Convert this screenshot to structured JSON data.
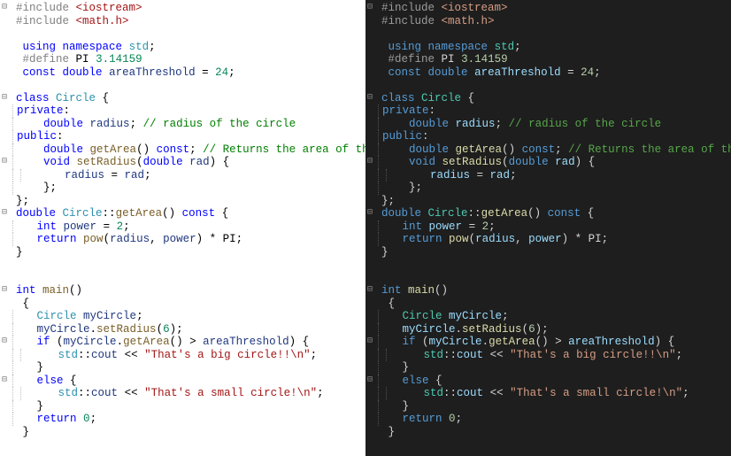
{
  "panes": [
    {
      "theme": "light"
    },
    {
      "theme": "dark"
    }
  ],
  "code_lines": [
    {
      "gutter": "⊟",
      "indent": 0,
      "tokens": [
        [
          "pp",
          "#include"
        ],
        [
          "p",
          " "
        ],
        [
          "s",
          "<iostream>"
        ]
      ]
    },
    {
      "gutter": "",
      "indent": 0,
      "tokens": [
        [
          "pp",
          "#include"
        ],
        [
          "p",
          " "
        ],
        [
          "s",
          "<math.h>"
        ]
      ]
    },
    {
      "gutter": "",
      "indent": 0,
      "tokens": []
    },
    {
      "gutter": "",
      "indent": 0,
      "tokens": [
        [
          "p",
          " "
        ],
        [
          "k",
          "using"
        ],
        [
          "p",
          " "
        ],
        [
          "k",
          "namespace"
        ],
        [
          "p",
          " "
        ],
        [
          "t",
          "std"
        ],
        [
          "p",
          ";"
        ]
      ]
    },
    {
      "gutter": "",
      "indent": 0,
      "tokens": [
        [
          "p",
          " "
        ],
        [
          "pp",
          "#define"
        ],
        [
          "p",
          " "
        ],
        [
          "d",
          "PI"
        ],
        [
          "p",
          " "
        ],
        [
          "n",
          "3.14159"
        ]
      ]
    },
    {
      "gutter": "",
      "indent": 0,
      "tokens": [
        [
          "p",
          " "
        ],
        [
          "k",
          "const"
        ],
        [
          "p",
          " "
        ],
        [
          "k",
          "double"
        ],
        [
          "p",
          " "
        ],
        [
          "v",
          "areaThreshold"
        ],
        [
          "p",
          " = "
        ],
        [
          "n",
          "24"
        ],
        [
          "p",
          ";"
        ]
      ]
    },
    {
      "gutter": "",
      "indent": 0,
      "tokens": []
    },
    {
      "gutter": "⊟",
      "indent": 0,
      "tokens": [
        [
          "k",
          "class"
        ],
        [
          "p",
          " "
        ],
        [
          "t",
          "Circle"
        ],
        [
          "p",
          " {"
        ]
      ]
    },
    {
      "gutter": "",
      "indent": 1,
      "tokens": [
        [
          "k",
          "private"
        ],
        [
          "p",
          ":"
        ]
      ]
    },
    {
      "gutter": "",
      "indent": 1,
      "tokens": [
        [
          "p",
          "    "
        ],
        [
          "k",
          "double"
        ],
        [
          "p",
          " "
        ],
        [
          "v",
          "radius"
        ],
        [
          "p",
          "; "
        ],
        [
          "c",
          "// radius of the circle"
        ]
      ]
    },
    {
      "gutter": "",
      "indent": 1,
      "tokens": [
        [
          "k",
          "public"
        ],
        [
          "p",
          ":"
        ]
      ]
    },
    {
      "gutter": "",
      "indent": 1,
      "tokens": [
        [
          "p",
          "    "
        ],
        [
          "k",
          "double"
        ],
        [
          "p",
          " "
        ],
        [
          "m",
          "getArea"
        ],
        [
          "p",
          "() "
        ],
        [
          "k",
          "const"
        ],
        [
          "p",
          "; "
        ],
        [
          "c",
          "// Returns the area of the circle"
        ]
      ]
    },
    {
      "gutter": "⊟",
      "indent": 1,
      "tokens": [
        [
          "p",
          "    "
        ],
        [
          "k",
          "void"
        ],
        [
          "p",
          " "
        ],
        [
          "m",
          "setRadius"
        ],
        [
          "p",
          "("
        ],
        [
          "k",
          "double"
        ],
        [
          "p",
          " "
        ],
        [
          "v",
          "rad"
        ],
        [
          "p",
          ") {"
        ]
      ]
    },
    {
      "gutter": "",
      "indent": 2,
      "tokens": [
        [
          "p",
          "      "
        ],
        [
          "v",
          "radius"
        ],
        [
          "p",
          " = "
        ],
        [
          "v",
          "rad"
        ],
        [
          "p",
          ";"
        ]
      ]
    },
    {
      "gutter": "",
      "indent": 1,
      "tokens": [
        [
          "p",
          "    };"
        ]
      ]
    },
    {
      "gutter": "",
      "indent": 0,
      "tokens": [
        [
          "p",
          "};"
        ]
      ]
    },
    {
      "gutter": "⊟",
      "indent": 0,
      "tokens": [
        [
          "k",
          "double"
        ],
        [
          "p",
          " "
        ],
        [
          "t",
          "Circle"
        ],
        [
          "p",
          "::"
        ],
        [
          "m",
          "getArea"
        ],
        [
          "p",
          "() "
        ],
        [
          "k",
          "const"
        ],
        [
          "p",
          " {"
        ]
      ]
    },
    {
      "gutter": "",
      "indent": 1,
      "tokens": [
        [
          "p",
          "   "
        ],
        [
          "k",
          "int"
        ],
        [
          "p",
          " "
        ],
        [
          "v",
          "power"
        ],
        [
          "p",
          " = "
        ],
        [
          "n",
          "2"
        ],
        [
          "p",
          ";"
        ]
      ]
    },
    {
      "gutter": "",
      "indent": 1,
      "tokens": [
        [
          "p",
          "   "
        ],
        [
          "k",
          "return"
        ],
        [
          "p",
          " "
        ],
        [
          "m",
          "pow"
        ],
        [
          "p",
          "("
        ],
        [
          "v",
          "radius"
        ],
        [
          "p",
          ", "
        ],
        [
          "v",
          "power"
        ],
        [
          "p",
          ") * "
        ],
        [
          "d",
          "PI"
        ],
        [
          "p",
          ";"
        ]
      ]
    },
    {
      "gutter": "",
      "indent": 0,
      "tokens": [
        [
          "p",
          "}"
        ]
      ]
    },
    {
      "gutter": "",
      "indent": 0,
      "tokens": []
    },
    {
      "gutter": "",
      "indent": 0,
      "tokens": []
    },
    {
      "gutter": "⊟",
      "indent": 0,
      "tokens": [
        [
          "k",
          "int"
        ],
        [
          "p",
          " "
        ],
        [
          "m",
          "main"
        ],
        [
          "p",
          "()"
        ]
      ]
    },
    {
      "gutter": "",
      "indent": 0,
      "tokens": [
        [
          "p",
          " {"
        ]
      ]
    },
    {
      "gutter": "",
      "indent": 1,
      "tokens": [
        [
          "p",
          "   "
        ],
        [
          "t",
          "Circle"
        ],
        [
          "p",
          " "
        ],
        [
          "v",
          "myCircle"
        ],
        [
          "p",
          ";"
        ]
      ]
    },
    {
      "gutter": "",
      "indent": 1,
      "tokens": [
        [
          "p",
          "   "
        ],
        [
          "v",
          "myCircle"
        ],
        [
          "p",
          "."
        ],
        [
          "m",
          "setRadius"
        ],
        [
          "p",
          "("
        ],
        [
          "n",
          "6"
        ],
        [
          "p",
          ");"
        ]
      ]
    },
    {
      "gutter": "⊟",
      "indent": 1,
      "tokens": [
        [
          "p",
          "   "
        ],
        [
          "k",
          "if"
        ],
        [
          "p",
          " ("
        ],
        [
          "v",
          "myCircle"
        ],
        [
          "p",
          "."
        ],
        [
          "m",
          "getArea"
        ],
        [
          "p",
          "() > "
        ],
        [
          "v",
          "areaThreshold"
        ],
        [
          "p",
          ") {"
        ]
      ]
    },
    {
      "gutter": "",
      "indent": 2,
      "tokens": [
        [
          "p",
          "     "
        ],
        [
          "t",
          "std"
        ],
        [
          "p",
          "::"
        ],
        [
          "v",
          "cout"
        ],
        [
          "p",
          " << "
        ],
        [
          "s",
          "\"That's a big circle!!\\n\""
        ],
        [
          "p",
          ";"
        ]
      ]
    },
    {
      "gutter": "",
      "indent": 1,
      "tokens": [
        [
          "p",
          "   }"
        ]
      ]
    },
    {
      "gutter": "⊟",
      "indent": 1,
      "tokens": [
        [
          "p",
          "   "
        ],
        [
          "k",
          "else"
        ],
        [
          "p",
          " {"
        ]
      ]
    },
    {
      "gutter": "",
      "indent": 2,
      "tokens": [
        [
          "p",
          "     "
        ],
        [
          "t",
          "std"
        ],
        [
          "p",
          "::"
        ],
        [
          "v",
          "cout"
        ],
        [
          "p",
          " << "
        ],
        [
          "s",
          "\"That's a small circle!\\n\""
        ],
        [
          "p",
          ";"
        ]
      ]
    },
    {
      "gutter": "",
      "indent": 1,
      "tokens": [
        [
          "p",
          "   }"
        ]
      ]
    },
    {
      "gutter": "",
      "indent": 1,
      "tokens": [
        [
          "p",
          "   "
        ],
        [
          "k",
          "return"
        ],
        [
          "p",
          " "
        ],
        [
          "n",
          "0"
        ],
        [
          "p",
          ";"
        ]
      ]
    },
    {
      "gutter": "",
      "indent": 0,
      "tokens": [
        [
          "p",
          " }"
        ]
      ]
    }
  ]
}
